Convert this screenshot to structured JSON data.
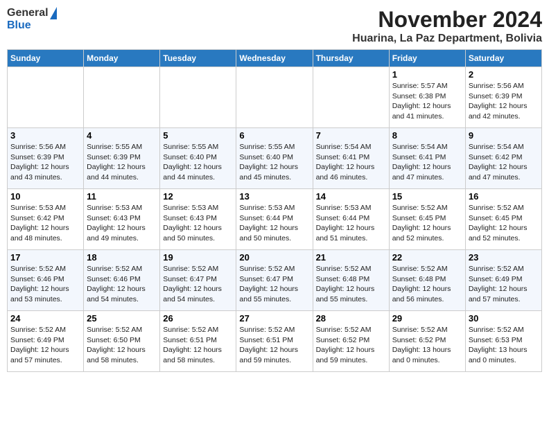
{
  "header": {
    "logo": {
      "general": "General",
      "blue": "Blue",
      "icon": "triangle"
    },
    "month": "November 2024",
    "location": "Huarina, La Paz Department, Bolivia"
  },
  "weekdays": [
    "Sunday",
    "Monday",
    "Tuesday",
    "Wednesday",
    "Thursday",
    "Friday",
    "Saturday"
  ],
  "weeks": [
    [
      {
        "day": "",
        "info": ""
      },
      {
        "day": "",
        "info": ""
      },
      {
        "day": "",
        "info": ""
      },
      {
        "day": "",
        "info": ""
      },
      {
        "day": "",
        "info": ""
      },
      {
        "day": "1",
        "info": "Sunrise: 5:57 AM\nSunset: 6:38 PM\nDaylight: 12 hours and 41 minutes."
      },
      {
        "day": "2",
        "info": "Sunrise: 5:56 AM\nSunset: 6:39 PM\nDaylight: 12 hours and 42 minutes."
      }
    ],
    [
      {
        "day": "3",
        "info": "Sunrise: 5:56 AM\nSunset: 6:39 PM\nDaylight: 12 hours and 43 minutes."
      },
      {
        "day": "4",
        "info": "Sunrise: 5:55 AM\nSunset: 6:39 PM\nDaylight: 12 hours and 44 minutes."
      },
      {
        "day": "5",
        "info": "Sunrise: 5:55 AM\nSunset: 6:40 PM\nDaylight: 12 hours and 44 minutes."
      },
      {
        "day": "6",
        "info": "Sunrise: 5:55 AM\nSunset: 6:40 PM\nDaylight: 12 hours and 45 minutes."
      },
      {
        "day": "7",
        "info": "Sunrise: 5:54 AM\nSunset: 6:41 PM\nDaylight: 12 hours and 46 minutes."
      },
      {
        "day": "8",
        "info": "Sunrise: 5:54 AM\nSunset: 6:41 PM\nDaylight: 12 hours and 47 minutes."
      },
      {
        "day": "9",
        "info": "Sunrise: 5:54 AM\nSunset: 6:42 PM\nDaylight: 12 hours and 47 minutes."
      }
    ],
    [
      {
        "day": "10",
        "info": "Sunrise: 5:53 AM\nSunset: 6:42 PM\nDaylight: 12 hours and 48 minutes."
      },
      {
        "day": "11",
        "info": "Sunrise: 5:53 AM\nSunset: 6:43 PM\nDaylight: 12 hours and 49 minutes."
      },
      {
        "day": "12",
        "info": "Sunrise: 5:53 AM\nSunset: 6:43 PM\nDaylight: 12 hours and 50 minutes."
      },
      {
        "day": "13",
        "info": "Sunrise: 5:53 AM\nSunset: 6:44 PM\nDaylight: 12 hours and 50 minutes."
      },
      {
        "day": "14",
        "info": "Sunrise: 5:53 AM\nSunset: 6:44 PM\nDaylight: 12 hours and 51 minutes."
      },
      {
        "day": "15",
        "info": "Sunrise: 5:52 AM\nSunset: 6:45 PM\nDaylight: 12 hours and 52 minutes."
      },
      {
        "day": "16",
        "info": "Sunrise: 5:52 AM\nSunset: 6:45 PM\nDaylight: 12 hours and 52 minutes."
      }
    ],
    [
      {
        "day": "17",
        "info": "Sunrise: 5:52 AM\nSunset: 6:46 PM\nDaylight: 12 hours and 53 minutes."
      },
      {
        "day": "18",
        "info": "Sunrise: 5:52 AM\nSunset: 6:46 PM\nDaylight: 12 hours and 54 minutes."
      },
      {
        "day": "19",
        "info": "Sunrise: 5:52 AM\nSunset: 6:47 PM\nDaylight: 12 hours and 54 minutes."
      },
      {
        "day": "20",
        "info": "Sunrise: 5:52 AM\nSunset: 6:47 PM\nDaylight: 12 hours and 55 minutes."
      },
      {
        "day": "21",
        "info": "Sunrise: 5:52 AM\nSunset: 6:48 PM\nDaylight: 12 hours and 55 minutes."
      },
      {
        "day": "22",
        "info": "Sunrise: 5:52 AM\nSunset: 6:48 PM\nDaylight: 12 hours and 56 minutes."
      },
      {
        "day": "23",
        "info": "Sunrise: 5:52 AM\nSunset: 6:49 PM\nDaylight: 12 hours and 57 minutes."
      }
    ],
    [
      {
        "day": "24",
        "info": "Sunrise: 5:52 AM\nSunset: 6:49 PM\nDaylight: 12 hours and 57 minutes."
      },
      {
        "day": "25",
        "info": "Sunrise: 5:52 AM\nSunset: 6:50 PM\nDaylight: 12 hours and 58 minutes."
      },
      {
        "day": "26",
        "info": "Sunrise: 5:52 AM\nSunset: 6:51 PM\nDaylight: 12 hours and 58 minutes."
      },
      {
        "day": "27",
        "info": "Sunrise: 5:52 AM\nSunset: 6:51 PM\nDaylight: 12 hours and 59 minutes."
      },
      {
        "day": "28",
        "info": "Sunrise: 5:52 AM\nSunset: 6:52 PM\nDaylight: 12 hours and 59 minutes."
      },
      {
        "day": "29",
        "info": "Sunrise: 5:52 AM\nSunset: 6:52 PM\nDaylight: 13 hours and 0 minutes."
      },
      {
        "day": "30",
        "info": "Sunrise: 5:52 AM\nSunset: 6:53 PM\nDaylight: 13 hours and 0 minutes."
      }
    ]
  ]
}
